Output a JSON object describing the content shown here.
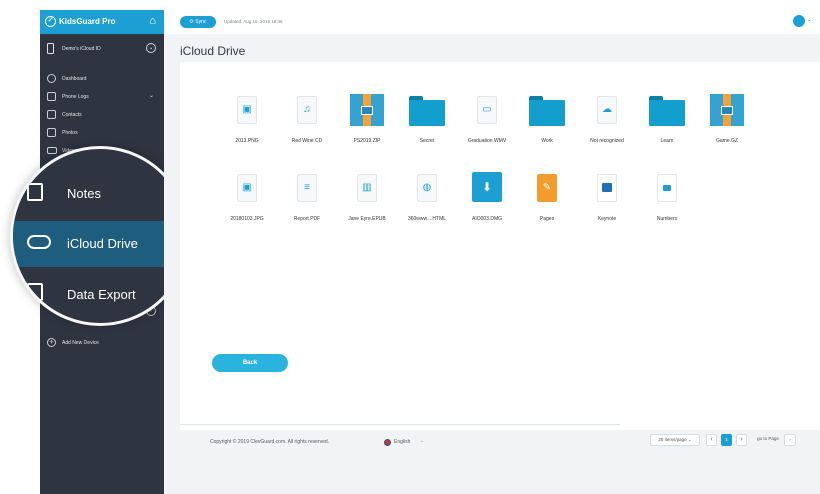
{
  "sidebar": {
    "brand": "KidsGuard Pro",
    "device_name": "Demo's iCloud ID",
    "items": [
      {
        "label": "Dashboard"
      },
      {
        "label": "Phone Logs"
      },
      {
        "label": "Contacts"
      },
      {
        "label": "Photos"
      },
      {
        "label": "Videos"
      }
    ],
    "add_device": "Add New Device"
  },
  "magnifier": {
    "items": [
      {
        "label": "Notes"
      },
      {
        "label": "iCloud Drive"
      },
      {
        "label": "Data Export"
      }
    ]
  },
  "topbar": {
    "sync_label": "Sync",
    "updated": "Updated: Aug 16, 2019 18:36"
  },
  "main": {
    "title": "iCloud Drive",
    "files": [
      {
        "name": "2013.PNG",
        "type": "image"
      },
      {
        "name": "Red Wine CD",
        "type": "audio"
      },
      {
        "name": "PS2019.ZIP",
        "type": "zip"
      },
      {
        "name": "Secret",
        "type": "folder"
      },
      {
        "name": "Graduation.WMV",
        "type": "video"
      },
      {
        "name": "Work",
        "type": "folder"
      },
      {
        "name": "Not recognized",
        "type": "unknown"
      },
      {
        "name": "Learn",
        "type": "folder"
      },
      {
        "name": "Game.GZ",
        "type": "zip"
      },
      {
        "name": "20180103.JPG",
        "type": "image"
      },
      {
        "name": "Report.PDF",
        "type": "document"
      },
      {
        "name": "Jane Eyre.EPUB",
        "type": "book"
      },
      {
        "name": "360www....HTML",
        "type": "web"
      },
      {
        "name": "AIO003.DMG",
        "type": "dmg"
      },
      {
        "name": "Pages",
        "type": "pages"
      },
      {
        "name": "Keynote",
        "type": "keynote"
      },
      {
        "name": "Numbers",
        "type": "numbers"
      }
    ],
    "back_label": "Back",
    "pagination": {
      "page_size": "20 items/page",
      "current_page": "1",
      "goto_label": "go to Page"
    }
  },
  "footer": {
    "copyright": "Copyright © 2019 ClevGuard.com. All rights reserved.",
    "language": "English"
  },
  "colors": {
    "accent": "#1d9fd3",
    "sidebar_bg": "#2e3540",
    "active_item": "#1f5d7f",
    "folder": "#129fcd",
    "zip_band": "#f3a23a",
    "main_bg": "#f2f3f5"
  }
}
